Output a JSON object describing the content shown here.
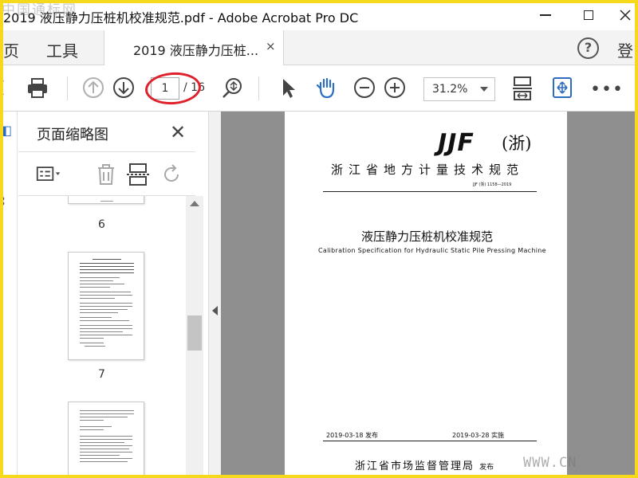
{
  "window": {
    "title": "2019 液压静力压桩机校准规范.pdf - Adobe Acrobat Pro DC"
  },
  "menu": {
    "home_label": "主页",
    "home_visible": "页",
    "tools_label": "工具",
    "doc_tab_label": "2019 液压静力压桩...",
    "doc_tab_close": "×",
    "help_label": "?",
    "login_label": "登"
  },
  "toolbar": {
    "current_page": "1",
    "total_pages": "/ 16",
    "zoom_level": "31.2%",
    "more_label": "•••",
    "icons": [
      "print-icon",
      "page-up-icon",
      "page-down-icon",
      "zoom-search-icon",
      "select-cursor-icon",
      "hand-tool-icon",
      "zoom-out-icon",
      "zoom-in-icon",
      "fit-page-icon",
      "scroll-mode-icon",
      "more-icon"
    ]
  },
  "thumbnail_panel": {
    "title": "页面缩略图",
    "close_label": "✕",
    "page_numbers": [
      "6",
      "7"
    ]
  },
  "document": {
    "logo": "JJF",
    "logo_suffix": "(浙)",
    "org": "浙江省地方计量技术规范",
    "code": "JJF (浙) 1158—2019",
    "title_zh": "液压静力压桩机校准规范",
    "title_en": "Calibration Specification for Hydraulic Static Pile Pressing Machine",
    "issue_date": "2019-03-18 发布",
    "impl_date": "2019-03-28 实施",
    "publisher": "浙江省市场监督管理局",
    "publisher_suffix": "发布"
  },
  "watermark": {
    "top": "中国通标网",
    "bottom": "WWW.CN"
  },
  "colors": {
    "frame": "#f5d91a",
    "annotation_ellipse": "#e0202a",
    "accent_blue": "#2d6cc0"
  }
}
